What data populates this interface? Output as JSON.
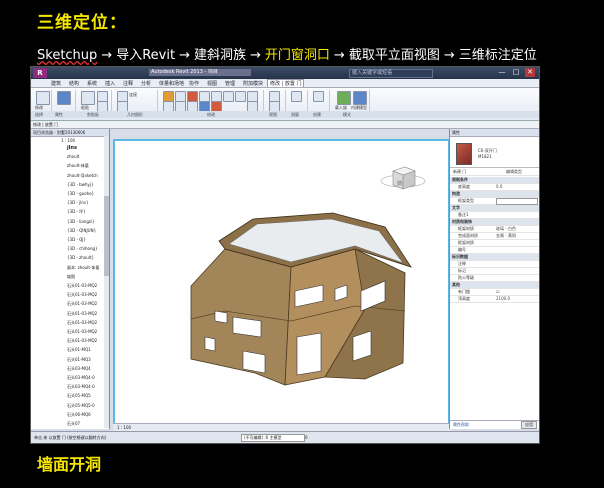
{
  "slide": {
    "title": "三维定位：",
    "workflow": [
      {
        "label": "Sketchup",
        "highlight": false
      },
      {
        "label": "导入Revit",
        "highlight": false
      },
      {
        "label": "建斜洞族",
        "highlight": false
      },
      {
        "label": "开门窗洞口",
        "highlight": true
      },
      {
        "label": "截取平立面视图",
        "highlight": false
      },
      {
        "label": "三维标注定位",
        "highlight": false
      }
    ],
    "arrow": "→",
    "caption": "墙面开洞"
  },
  "revit": {
    "logo": "R",
    "document_tab": "Autodesk Revit 2013 - 项目",
    "search_placeholder": "键入关键字或短语",
    "window_controls": [
      "—",
      "□",
      "✕"
    ],
    "menu_tabs": [
      "建筑",
      "结构",
      "系统",
      "插入",
      "注释",
      "分析",
      "体量和场地",
      "协作",
      "视图",
      "管理",
      "附加模块",
      "修改 | 放置 门"
    ],
    "active_tab_index": 11,
    "ribbon_labels": {
      "modify": "修改",
      "clipboard_paste": "粘贴",
      "cut_join": "连接",
      "select": "选择",
      "properties": "属性",
      "clipboard": "剪贴板",
      "geometry": "几何图形",
      "modify_panel": "修改",
      "view": "视图",
      "measure": "测量",
      "create": "创建",
      "mode": "模式",
      "tag": "在放置时进行标记",
      "load_family": "载入族",
      "inplace": "内建模型"
    },
    "context_line": "修改 | 放置 门",
    "project_browser": {
      "header": "项目浏览器 - 别墅20130606",
      "scale": "1 : 100",
      "items": [
        "jlns",
        "zhoult",
        "zhoult-体量",
        "zhoult-导sketch",
        "{3D - bwhyj}",
        "{3D - guohe}",
        "{3D - jlns}",
        "{3D - 坪}",
        "{3D - liangzi}",
        "{3D - QINJUN}",
        "{3D - QJ}",
        "{3D - chihong}",
        "{3D - zhoult}",
        "副本: zhoult-体量",
        "坡图",
        "石头01-03-MQ2",
        "石头01-03-MQ2",
        "石头01-03-MQ2",
        "石头01-03-MQ2",
        "石头01-03-MQ2",
        "石头01-03-MQ2",
        "石头01-03-MQ2",
        "石头01-MQ1",
        "石头01-MQ3",
        "石头03-MQ4",
        "石头03-MQ4-0",
        "石头03-MQ4-0",
        "石头05-MQ5",
        "石头05-MQ5-0",
        "石头06-MQ6",
        "石头07"
      ]
    },
    "viewport": {
      "scale_label": "1 : 100",
      "viewcube_label": "前"
    },
    "properties": {
      "header": "属性",
      "type_name": "C6-双开门",
      "type_size": "M1821",
      "instance_selector": "新建 门",
      "edit_type": "编辑类型",
      "rows": [
        {
          "section": true,
          "key": "限制条件"
        },
        {
          "key": "底高度",
          "value": "0.0"
        },
        {
          "section": true,
          "key": "构造"
        },
        {
          "key": "框架类型",
          "box": true
        },
        {
          "section": true,
          "key": "文字"
        },
        {
          "key": "备注1",
          "value": ""
        },
        {
          "section": true,
          "key": "材质和装饰"
        },
        {
          "key": "框架材质",
          "value": "玻璃 - 白色"
        },
        {
          "key": "完成面材质",
          "value": "金属 - 黄铜"
        },
        {
          "key": "框架材质",
          "value": ""
        },
        {
          "key": "编号",
          "value": ""
        },
        {
          "section": true,
          "key": "标识数据"
        },
        {
          "key": "注释",
          "value": ""
        },
        {
          "key": "标记",
          "value": ""
        },
        {
          "key": "防火等级",
          "value": ""
        },
        {
          "section": true,
          "key": "其他"
        },
        {
          "key": "有门槛",
          "value": "☑"
        },
        {
          "key": "顶高度",
          "value": "2100.0"
        }
      ],
      "help_link": "属性帮助",
      "apply_button": "应用"
    },
    "status": {
      "hint": "单击 来 以放置 门 (按空格键以翻转方向)",
      "dropdown_value": "(不可编辑) :0 主模型",
      "count": "0"
    }
  }
}
